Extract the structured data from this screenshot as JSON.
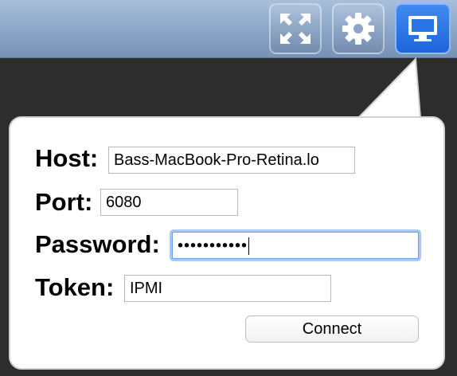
{
  "toolbar": {
    "buttons": [
      {
        "name": "fullscreen",
        "icon": "fullscreen-arrows-icon"
      },
      {
        "name": "settings",
        "icon": "gear-icon"
      },
      {
        "name": "connection",
        "icon": "monitor-icon",
        "active": true
      }
    ]
  },
  "connection_form": {
    "host_label": "Host:",
    "host_value": "Bass-MacBook-Pro-Retina.lo",
    "port_label": "Port:",
    "port_value": "6080",
    "password_label": "Password:",
    "password_value": "•••••••••••",
    "token_label": "Token:",
    "token_value": "IPMI",
    "connect_label": "Connect"
  },
  "colors": {
    "topbar": "#8aa5c7",
    "active_button": "#2b74e6",
    "background": "#2d2d2d",
    "focus_ring": "#a6c8f5"
  }
}
